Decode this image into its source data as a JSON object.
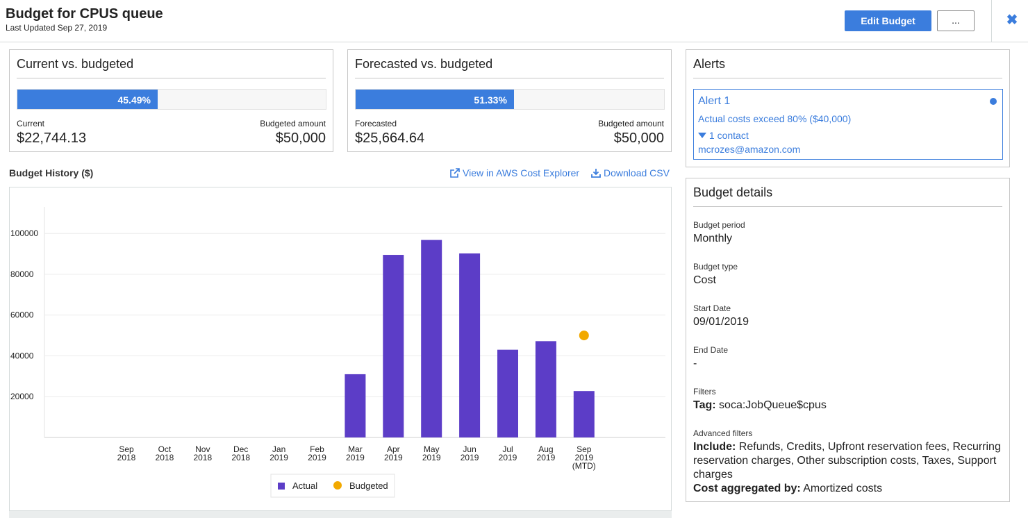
{
  "header": {
    "title": "Budget for CPUS queue",
    "last_updated": "Last Updated Sep 27, 2019",
    "edit_label": "Edit Budget",
    "more_label": "...",
    "close_label": "✖"
  },
  "current_panel": {
    "title": "Current vs. budgeted",
    "percent_label": "45.49%",
    "percent": 45.49,
    "left_label": "Current",
    "left_value": "$22,744.13",
    "right_label": "Budgeted amount",
    "right_value": "$50,000"
  },
  "forecast_panel": {
    "title": "Forecasted vs. budgeted",
    "percent_label": "51.33%",
    "percent": 51.33,
    "left_label": "Forecasted",
    "left_value": "$25,664.64",
    "right_label": "Budgeted amount",
    "right_value": "$50,000"
  },
  "history": {
    "title": "Budget History ($)",
    "view_link": "View in AWS Cost Explorer",
    "download_link": "Download CSV"
  },
  "chart_data": {
    "type": "bar",
    "categories": [
      [
        "Sep",
        "2018"
      ],
      [
        "Oct",
        "2018"
      ],
      [
        "Nov",
        "2018"
      ],
      [
        "Dec",
        "2018"
      ],
      [
        "Jan",
        "2019"
      ],
      [
        "Feb",
        "2019"
      ],
      [
        "Mar",
        "2019"
      ],
      [
        "Apr",
        "2019"
      ],
      [
        "May",
        "2019"
      ],
      [
        "Jun",
        "2019"
      ],
      [
        "Jul",
        "2019"
      ],
      [
        "Aug",
        "2019"
      ],
      [
        "Sep",
        "2019",
        "(MTD)"
      ]
    ],
    "series": [
      {
        "name": "Actual",
        "values": [
          null,
          null,
          null,
          null,
          null,
          null,
          31000,
          89500,
          96800,
          90200,
          43000,
          47200,
          22744
        ]
      },
      {
        "name": "Budgeted",
        "values": [
          null,
          null,
          null,
          null,
          null,
          null,
          null,
          null,
          null,
          null,
          null,
          null,
          50000
        ]
      }
    ],
    "yticks": [
      20000,
      40000,
      60000,
      80000,
      100000
    ],
    "ylim": [
      0,
      113000
    ],
    "grid": true,
    "legend": "bottom-center",
    "colors": {
      "actual": "#5c3dc7",
      "budgeted": "#f2a900"
    }
  },
  "alerts": {
    "title": "Alerts",
    "items": [
      {
        "name": "Alert 1",
        "description": "Actual costs exceed 80% ($40,000)",
        "contacts": "1 contact",
        "email": "mcrozes@amazon.com"
      }
    ]
  },
  "details": {
    "title": "Budget details",
    "period_label": "Budget period",
    "period_value": "Monthly",
    "type_label": "Budget type",
    "type_value": "Cost",
    "start_label": "Start Date",
    "start_value": "09/01/2019",
    "end_label": "End Date",
    "end_value": "-",
    "filters_label": "Filters",
    "filters_key": "Tag:",
    "filters_value": " soca:JobQueue$cpus",
    "adv_label": "Advanced filters",
    "include_key": "Include:",
    "include_value": " Refunds, Credits, Upfront reservation fees, Recurring reservation charges, Other subscription costs, Taxes, Support charges",
    "agg_key": "Cost aggregated by:",
    "agg_value": " Amortized costs"
  },
  "accent_color": "#3b7ddd"
}
